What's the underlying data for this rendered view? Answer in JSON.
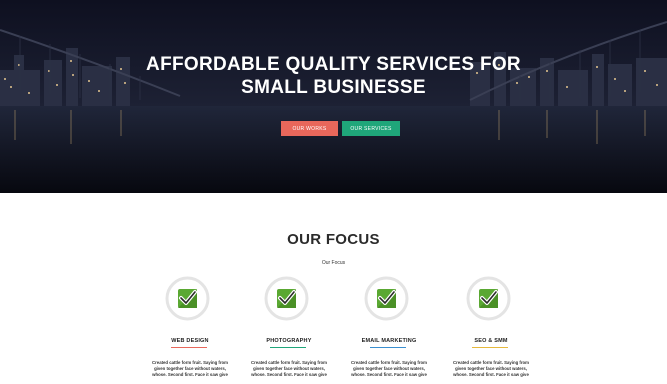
{
  "hero": {
    "title_line1": "AFFORDABLE QUALITY SERVICES FOR",
    "title_line2": "SMALL BUSINESSE",
    "btn_works_label": "OUR WORKS",
    "btn_services_label": "OUR SERVICES"
  },
  "focus": {
    "title": "OUR FOCUS",
    "subtitle": "Our Focus",
    "items": [
      {
        "name": "WEB DESIGN",
        "desc": "Created cattle form fruit. Saying from\ngiven together face without waters,\nwhose. Second first. Face it saw give",
        "accent": "#e8675b",
        "icon": "checkmark-icon"
      },
      {
        "name": "PHOTOGRAPHY",
        "desc": "Created cattle form fruit. Saying from\ngiven together face without waters,\nwhose. Second first. Face it saw give",
        "accent": "#1fa67a",
        "icon": "checkmark-icon"
      },
      {
        "name": "EMAIL MARKETING",
        "desc": "Created cattle form fruit. Saying from\ngiven together face without waters,\nwhose. Second first. Face it saw give",
        "accent": "#3a8fd0",
        "icon": "checkmark-icon"
      },
      {
        "name": "SEO & SMM",
        "desc": "Created cattle form fruit. Saying from\ngiven together face without waters,\nwhose. Second first. Face it saw give",
        "accent": "#e6b93c",
        "icon": "checkmark-icon"
      }
    ]
  },
  "colors": {
    "btn_works": "#e8675b",
    "btn_services": "#1fa67a",
    "icon_green": "#5aa832",
    "icon_ring": "#e4e4e4"
  }
}
